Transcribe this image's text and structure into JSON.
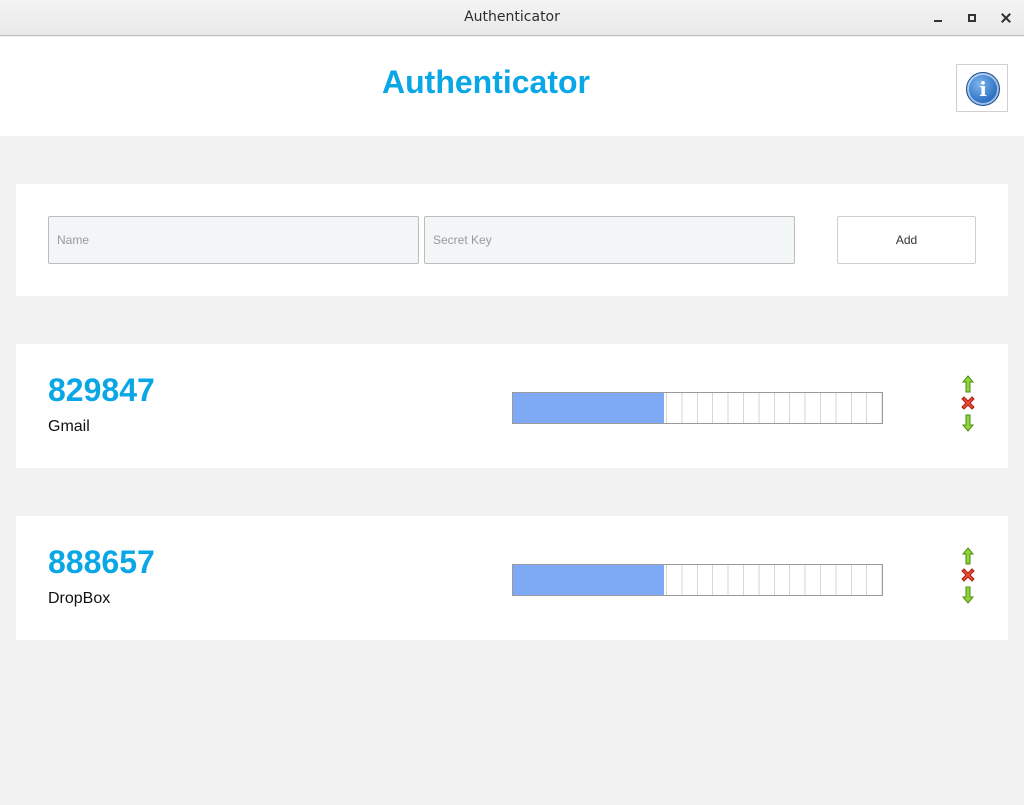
{
  "window": {
    "title": "Authenticator"
  },
  "header": {
    "title": "Authenticator",
    "info_icon": "info-icon"
  },
  "add_form": {
    "name_placeholder": "Name",
    "name_value": "",
    "secret_placeholder": "Secret Key",
    "secret_value": "",
    "add_label": "Add"
  },
  "accounts": [
    {
      "code": "829847",
      "name": "Gmail",
      "progress": 0.41
    },
    {
      "code": "888657",
      "name": "DropBox",
      "progress": 0.41
    }
  ],
  "colors": {
    "accent": "#0aa7e6",
    "progress_fill": "#7eaaf5",
    "up_arrow": "#7ccc1a",
    "delete": "#e53a2a"
  }
}
